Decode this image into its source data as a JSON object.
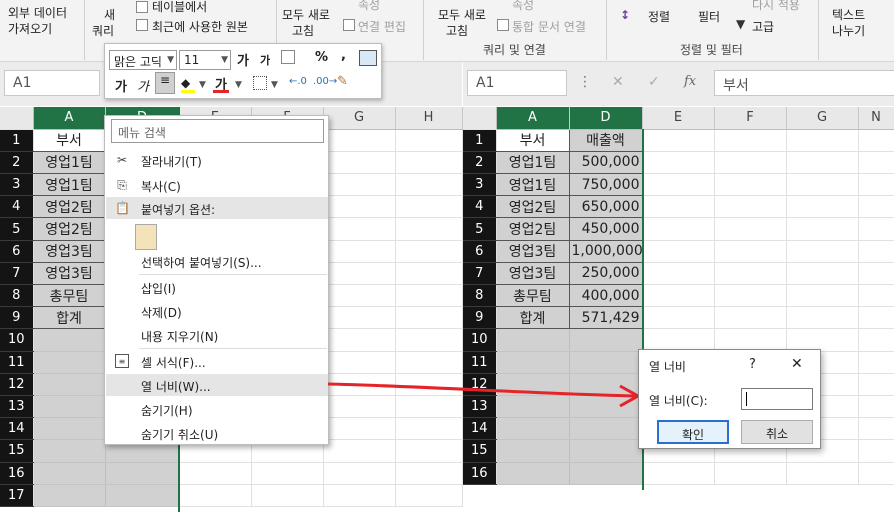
{
  "ribbon": {
    "ext_data_1": "외부 데이터",
    "ext_data_2": "가져오기",
    "query_1": "새",
    "query_2": "쿼리",
    "table_from": "테이블에서",
    "recent_sources": "최근에 사용한 원본",
    "refresh_1": "모두 새로",
    "refresh_2": "고침",
    "props_left": "속성",
    "edit_links_left": "연결 편집",
    "refresh_all_1": "모두 새로",
    "refresh_all_2": "고침",
    "props_right": "속성",
    "edit_links_right": "통합 문서 연결",
    "group_query": "쿼리 및 연결",
    "sort": "정렬",
    "filter": "필터",
    "reapply": "다시 적용",
    "advanced": "고급",
    "group_sort": "정렬 및 필터",
    "text_1": "텍스트",
    "text_2": "나누기"
  },
  "left_sheet": {
    "name_box": "A1",
    "columns": [
      "A",
      "D",
      "E",
      "F",
      "G",
      "H"
    ],
    "rows": [
      "1",
      "2",
      "3",
      "4",
      "5",
      "6",
      "7",
      "8",
      "9",
      "10",
      "11",
      "12",
      "13",
      "14",
      "15",
      "16",
      "17"
    ],
    "colA": [
      "부서",
      "영업1팀",
      "영업1팀",
      "영업2팀",
      "영업2팀",
      "영업3팀",
      "영업3팀",
      "총무팀",
      "합계"
    ]
  },
  "mini_toolbar": {
    "font": "맑은 고딕",
    "size": "11",
    "grow": "가",
    "shrink": "가",
    "percent": "%",
    "comma": ",",
    "bold": "가",
    "italic": "가",
    "font_color": "가"
  },
  "context_menu": {
    "search": "메뉴 검색",
    "items": [
      {
        "label": "잘라내기(T)"
      },
      {
        "label": "복사(C)"
      },
      {
        "label": "붙여넣기 옵션:"
      },
      {
        "label": "선택하여 붙여넣기(S)..."
      },
      {
        "label": "삽입(I)"
      },
      {
        "label": "삭제(D)"
      },
      {
        "label": "내용 지우기(N)"
      },
      {
        "label": "셀 서식(F)..."
      },
      {
        "label": "열 너비(W)..."
      },
      {
        "label": "숨기기(H)"
      },
      {
        "label": "숨기기 취소(U)"
      }
    ]
  },
  "right_sheet": {
    "name_box": "A1",
    "formula_value": "부서",
    "fx": "fx",
    "columns": [
      "A",
      "D",
      "E",
      "F",
      "G",
      "N"
    ],
    "rows": [
      "1",
      "2",
      "3",
      "4",
      "5",
      "6",
      "7",
      "8",
      "9",
      "10",
      "11",
      "12",
      "13",
      "14",
      "15",
      "16"
    ],
    "colA": [
      "부서",
      "영업1팀",
      "영업1팀",
      "영업2팀",
      "영업2팀",
      "영업3팀",
      "영업3팀",
      "총무팀",
      "합계"
    ],
    "colD": [
      "매출액",
      "500,000",
      "750,000",
      "650,000",
      "450,000",
      "1,000,000",
      "250,000",
      "400,000",
      "571,429"
    ]
  },
  "dialog": {
    "title": "열 너비",
    "help": "?",
    "close": "✕",
    "field_label": "열 너비(C):",
    "field_value": "",
    "ok": "확인",
    "cancel": "취소"
  },
  "colors": {
    "accent": "#217346",
    "arrow": "#e5242a"
  }
}
